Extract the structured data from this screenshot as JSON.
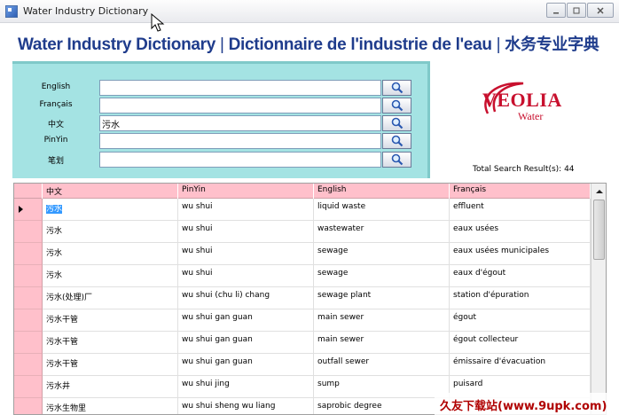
{
  "window": {
    "title": "Water Industry Dictionary"
  },
  "banner": {
    "english": "Water Industry Dictionary",
    "french": "Dictionnaire de l'industrie de l'eau",
    "chinese": "水务专业字典",
    "separator": "|"
  },
  "search": {
    "fields": [
      {
        "label": "English",
        "value": ""
      },
      {
        "label": "Français",
        "value": ""
      },
      {
        "label": "中文",
        "value": "污水"
      },
      {
        "label": "PinYin",
        "value": ""
      },
      {
        "label": "笔划",
        "value": ""
      }
    ]
  },
  "logo": {
    "name": "VEOLIA",
    "sub": "Water"
  },
  "results": {
    "total_label": "Total Search Result(s): 44",
    "columns": [
      "中文",
      "PinYin",
      "English",
      "Français"
    ],
    "rows": [
      [
        "污水",
        "wu shui",
        "liquid waste",
        "effluent"
      ],
      [
        "污水",
        "wu shui",
        "wastewater",
        "eaux usées"
      ],
      [
        "污水",
        "wu shui",
        "sewage",
        "eaux usées municipales"
      ],
      [
        "污水",
        "wu shui",
        "sewage",
        "eaux d'égout"
      ],
      [
        "污水(处理)厂",
        "wu shui (chu li) chang",
        "sewage plant",
        "station d'épuration"
      ],
      [
        "污水干管",
        "wu shui gan guan",
        "main sewer",
        "égout"
      ],
      [
        "污水干管",
        "wu shui gan guan",
        "main sewer",
        "égout collecteur"
      ],
      [
        "污水干管",
        "wu shui gan guan",
        "outfall sewer",
        "émissaire d'évacuation"
      ],
      [
        "污水井",
        "wu shui jing",
        "sump",
        "puisard"
      ],
      [
        "污水生物里",
        "wu shui sheng wu liang",
        "saprobic degree",
        ""
      ]
    ]
  },
  "watermark": "久友下载站(www.9upk.com)",
  "colors": {
    "panel": "#a4e3e3",
    "header": "#ffc0cb",
    "banner": "#1f3c8c",
    "logo": "#c8102e"
  }
}
